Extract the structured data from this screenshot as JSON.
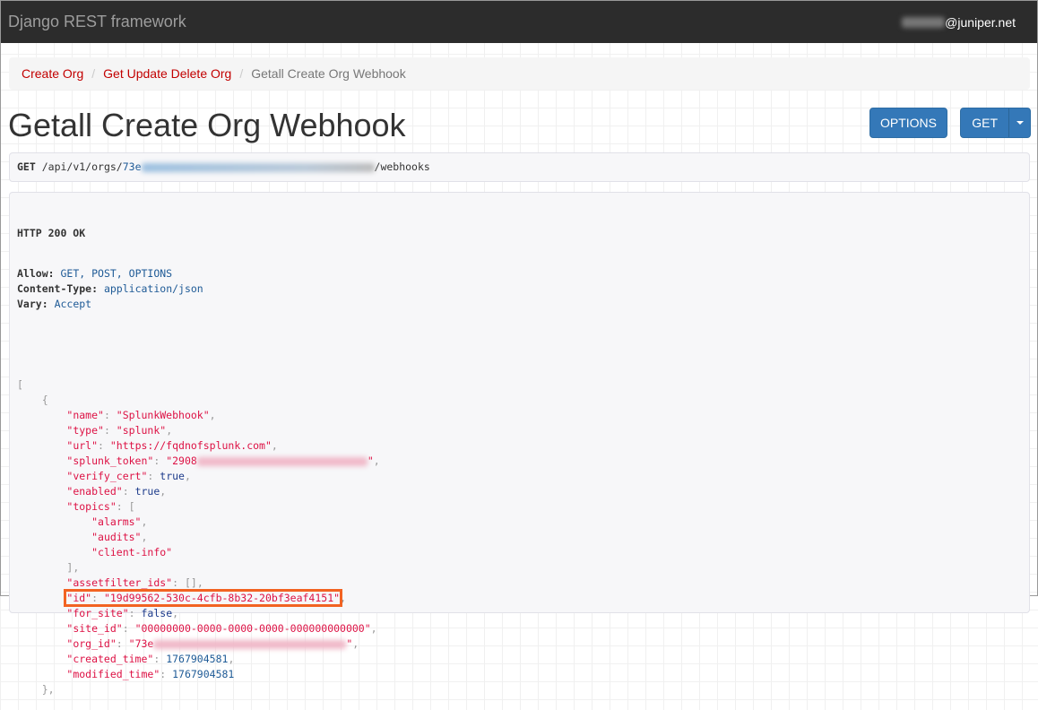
{
  "navbar": {
    "brand": "Django REST framework",
    "user_suffix": "@juniper.net"
  },
  "breadcrumb": [
    {
      "label": "Create Org"
    },
    {
      "label": "Get Update Delete Org"
    },
    {
      "label": "Getall Create Org Webhook"
    }
  ],
  "page_title": "Getall Create Org Webhook",
  "buttons": {
    "options": "OPTIONS",
    "get": "GET"
  },
  "request": {
    "method": "GET",
    "path_prefix": "/api/v1/orgs/",
    "org_prefix": "73e",
    "path_suffix": "/webhooks"
  },
  "response": {
    "status": "HTTP 200 OK",
    "headers": [
      {
        "name": "Allow:",
        "value": "GET, POST, OPTIONS"
      },
      {
        "name": "Content-Type:",
        "value": "application/json"
      },
      {
        "name": "Vary:",
        "value": "Accept"
      }
    ],
    "body": [
      {
        "i": 0,
        "p": "["
      },
      {
        "i": 1,
        "p": "{"
      },
      {
        "i": 2,
        "k": "\"name\"",
        "v": "\"SplunkWebhook\"",
        "t": "str",
        "s": ","
      },
      {
        "i": 2,
        "k": "\"type\"",
        "v": "\"splunk\"",
        "t": "str",
        "s": ","
      },
      {
        "i": 2,
        "k": "\"url\"",
        "v": "\"https://fqdnofsplunk.com\"",
        "t": "str",
        "s": ","
      },
      {
        "i": 2,
        "k": "\"splunk_token\"",
        "v": "\"2908",
        "t": "str",
        "blur": 190,
        "tail": "\"",
        "s": ","
      },
      {
        "i": 2,
        "k": "\"verify_cert\"",
        "v": "true",
        "t": "kw",
        "s": ","
      },
      {
        "i": 2,
        "k": "\"enabled\"",
        "v": "true",
        "t": "kw",
        "s": ","
      },
      {
        "i": 2,
        "k": "\"topics\"",
        "v": "[",
        "t": "pun"
      },
      {
        "i": 3,
        "v": "\"alarms\"",
        "t": "str",
        "s": ","
      },
      {
        "i": 3,
        "v": "\"audits\"",
        "t": "str",
        "s": ","
      },
      {
        "i": 3,
        "v": "\"client-info\"",
        "t": "str"
      },
      {
        "i": 2,
        "p": "],"
      },
      {
        "i": 2,
        "k": "\"assetfilter_ids\"",
        "v": "[]",
        "t": "pun",
        "s": ","
      },
      {
        "i": 2,
        "k": "\"id\"",
        "v": "\"19d99562-530c-4cfb-8b32-20bf3eaf4151\"",
        "t": "str",
        "s": ",",
        "hl": true
      },
      {
        "i": 2,
        "k": "\"for_site\"",
        "v": "false",
        "t": "kw",
        "s": ","
      },
      {
        "i": 2,
        "k": "\"site_id\"",
        "v": "\"00000000-0000-0000-0000-000000000000\"",
        "t": "str",
        "s": ","
      },
      {
        "i": 2,
        "k": "\"org_id\"",
        "v": "\"73e",
        "t": "str",
        "blur": 215,
        "tail": "\"",
        "s": ","
      },
      {
        "i": 2,
        "k": "\"created_time\"",
        "v": "1767904581",
        "t": "num",
        "s": ","
      },
      {
        "i": 2,
        "k": "\"modified_time\"",
        "v": "1767904581",
        "t": "num"
      },
      {
        "i": 1,
        "p": "},"
      }
    ]
  },
  "colors": {
    "navbar": "#2c2c2c",
    "link": "#c20000",
    "primary": "#3478b8",
    "highlight": "#f26322"
  }
}
